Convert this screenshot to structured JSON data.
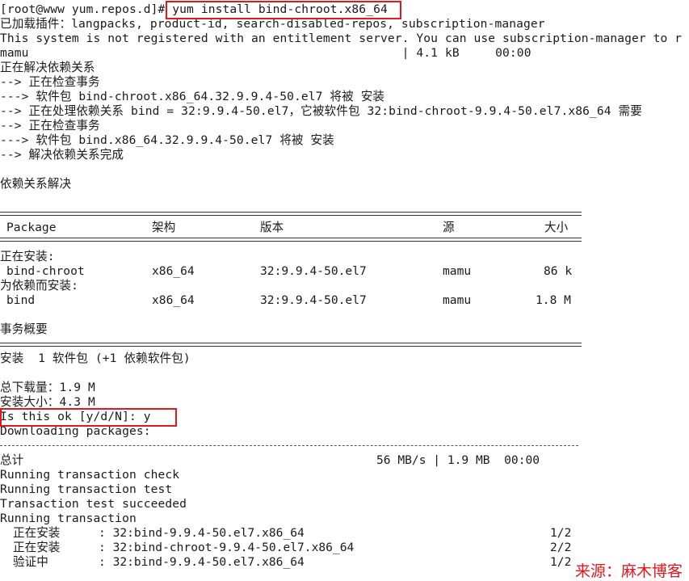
{
  "terminal": {
    "lines": [
      "[root@www yum.repos.d]# yum install bind-chroot.x86_64",
      "已加载插件：langpacks, product-id, search-disabled-repos, subscription-manager",
      "This system is not registered with an entitlement server. You can use subscription-manager to r",
      "mamu                                                    | 4.1 kB     00:00",
      "正在解决依赖关系",
      "--> 正在检查事务",
      "---> 软件包 bind-chroot.x86_64.32.9.9.4-50.el7 将被 安装",
      "--> 正在处理依赖关系 bind = 32:9.9.4-50.el7，它被软件包 32:bind-chroot-9.9.4-50.el7.x86_64 需要",
      "--> 正在检查事务",
      "---> 软件包 bind.x86_64.32.9.9.4-50.el7 将被 安装",
      "--> 解决依赖关系完成",
      "依赖关系解决"
    ],
    "table": {
      "headers": [
        "Package",
        "架构",
        "版本",
        "源",
        "大小"
      ],
      "group_installing": "正在安装:",
      "group_deps": "为依赖而安装:",
      "rows": [
        [
          "bind-chroot",
          "x86_64",
          "32:9.9.4-50.el7",
          "mamu",
          "86 k"
        ],
        [
          "bind",
          "x86_64",
          "32:9.9.4-50.el7",
          "mamu",
          "1.8 M"
        ]
      ]
    },
    "summary": {
      "title": "事务概要",
      "install": "安装  1 软件包 (+1 依赖软件包)",
      "download_size": "总下载量：1.9 M",
      "installed_size": "安装大小：4.3 M",
      "prompt": "Is this ok [y/d/N]: y",
      "downloading": "Downloading packages:",
      "total_label": "总计",
      "total_stats": "56 MB/s | 1.9 MB  00:00"
    },
    "transaction": [
      "Running transaction check",
      "Running transaction test",
      "Transaction test succeeded",
      "Running transaction"
    ],
    "steps": [
      {
        "action": "正在安装",
        "pkg": ": 32:bind-9.9.4-50.el7.x86_64",
        "count": "1/2"
      },
      {
        "action": "正在安装",
        "pkg": ": 32:bind-chroot-9.9.4-50.el7.x86_64",
        "count": "2/2"
      },
      {
        "action": "验证中",
        "pkg": ": 32:bind-9.9.4-50.el7.x86_64",
        "count": "1/2"
      }
    ]
  },
  "watermark": "来源：麻木博客",
  "colors": {
    "highlight": "#e0191f",
    "text": "#1a1a1a",
    "background": "#ffffff"
  }
}
